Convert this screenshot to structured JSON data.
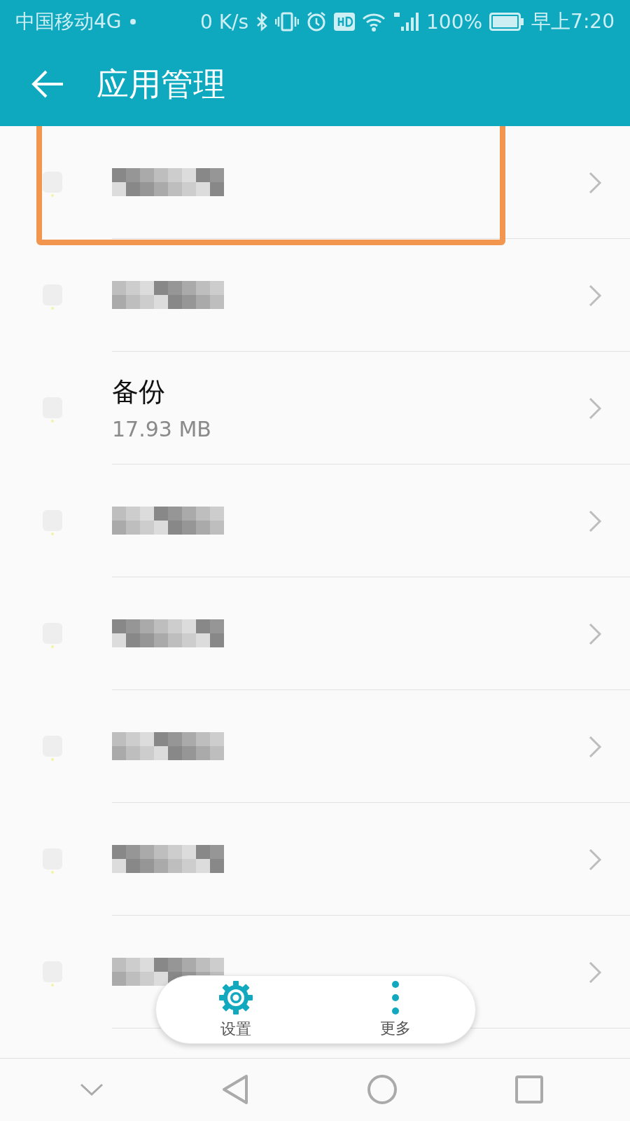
{
  "status_bar": {
    "carrier": "中国移动4G",
    "speed": "0 K/s",
    "battery": "100%",
    "time": "早上7:20"
  },
  "header": {
    "title": "应用管理"
  },
  "apps": [
    {
      "kind": "redacted",
      "highlighted": true
    },
    {
      "kind": "redacted",
      "highlighted": false
    },
    {
      "kind": "app",
      "name": "备份",
      "size": "17.93 MB",
      "highlighted": false
    },
    {
      "kind": "redacted",
      "highlighted": false
    },
    {
      "kind": "redacted",
      "highlighted": false
    },
    {
      "kind": "redacted",
      "highlighted": false
    },
    {
      "kind": "redacted",
      "highlighted": false
    },
    {
      "kind": "redacted",
      "highlighted": false
    }
  ],
  "toolbar": [
    {
      "kind": "settings",
      "label": "设置"
    },
    {
      "kind": "more",
      "label": "更多"
    }
  ]
}
